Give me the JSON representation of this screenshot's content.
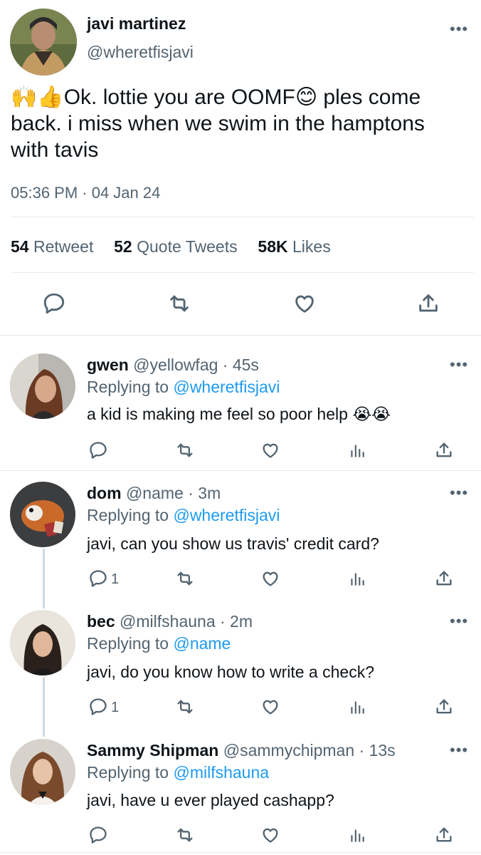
{
  "main_tweet": {
    "display_name": "javi martinez",
    "handle": "@wheretfisjavi",
    "text_line1_after_emoji": "Ok. lottie  you are OOMF",
    "text_line1_end": " ples come",
    "text_line2": "back. i miss when we swim in the hamptons",
    "text_line3": "with tavis",
    "emoji_leading": "🙌👍",
    "emoji_inline": "😊",
    "timestamp": "05:36 PM · 04 Jan 24",
    "stats": {
      "retweets_count": "54",
      "retweets_label": "Retweet",
      "quotes_count": "52",
      "quotes_label": "Quote Tweets",
      "likes_count": "58K",
      "likes_label": "Likes"
    }
  },
  "replies": [
    {
      "display_name": "gwen",
      "handle": "@yellowfag",
      "time": "· 45s",
      "replying_prefix": "Replying to",
      "replying_to": "@wheretfisjavi",
      "text": "a kid is making me feel so poor help",
      "emoji": "😭😭",
      "reply_count": ""
    },
    {
      "display_name": "dom",
      "handle": "@name",
      "time": "· 3m",
      "replying_prefix": "Replying to",
      "replying_to": "@wheretfisjavi",
      "text": "javi, can you show us travis' credit card?",
      "reply_count": "1"
    },
    {
      "display_name": "bec",
      "handle": "@milfshauna",
      "time": "· 2m",
      "replying_prefix": "Replying to",
      "replying_to": "@name",
      "text": "javi, do you know how to write a check?",
      "reply_count": "1"
    },
    {
      "display_name": "Sammy Shipman",
      "handle": "@sammychipman",
      "time": "· 13s",
      "replying_prefix": "Replying to",
      "replying_to": "@milfshauna",
      "text": "javi, have u ever played cashapp?",
      "reply_count": ""
    }
  ],
  "icons": {
    "more": "more-horizontal-icon",
    "reply": "comment-bubble-icon",
    "retweet": "retweet-arrows-icon",
    "like": "heart-icon",
    "views": "bar-chart-icon",
    "share": "share-upload-icon"
  },
  "colors": {
    "link": "#1d9bf0",
    "muted": "#536471",
    "text": "#0f1419",
    "divider": "#e6ecf0"
  }
}
